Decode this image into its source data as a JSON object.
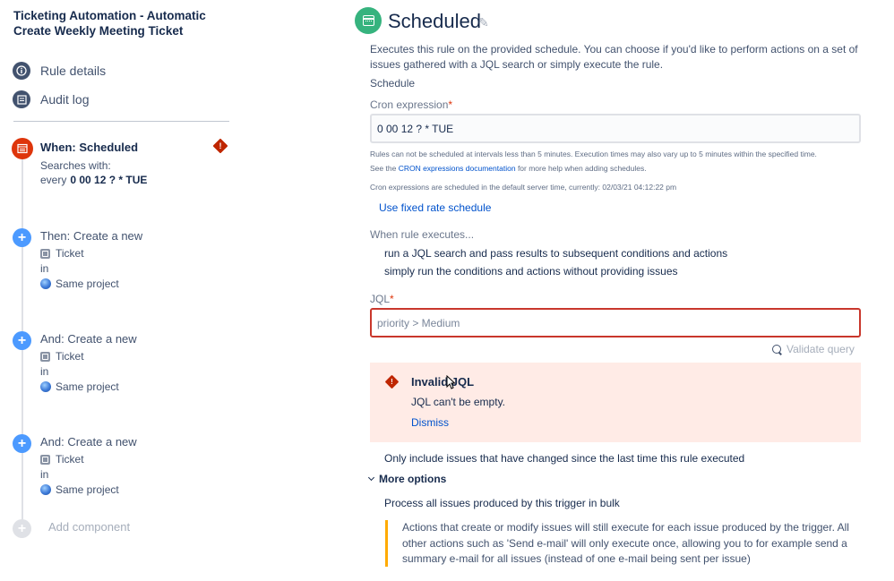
{
  "rule": {
    "title": "Ticketing Automation - Automatic Create Weekly Meeting Ticket"
  },
  "nav": {
    "rule_details": "Rule details",
    "audit_log": "Audit log"
  },
  "components": {
    "trigger": {
      "title": "When: Scheduled",
      "line1": "Searches with:",
      "line2_prefix": "every",
      "line2_value": "0 00 12 ? * TUE"
    },
    "actions": [
      {
        "title": "Then: Create a new",
        "issue_type": "Ticket",
        "in": "in",
        "project": "Same project"
      },
      {
        "title": "And: Create a new",
        "issue_type": "Ticket",
        "in": "in",
        "project": "Same project"
      },
      {
        "title": "And: Create a new",
        "issue_type": "Ticket",
        "in": "in",
        "project": "Same project"
      }
    ],
    "add_component": "Add component"
  },
  "panel": {
    "title": "Scheduled",
    "description": "Executes this rule on the provided schedule. You can choose if you'd like to perform actions on a set of issues gathered with a JQL search or simply execute the rule.",
    "schedule_heading": "Schedule",
    "cron_label": "Cron expression",
    "cron_value": "0 00 12 ? * TUE",
    "help_line1": "Rules can not be scheduled at intervals less than 5 minutes. Execution times may also vary up to 5 minutes within the specified time.",
    "help_line2_prefix": "See the",
    "help_line2_link": "CRON expressions documentation",
    "help_line2_suffix": "for more help when adding schedules.",
    "help_line3": "Cron expressions are scheduled in the default server time, currently: 02/03/21 04:12:22 pm",
    "fixed_rate_link": "Use fixed rate schedule",
    "when_executes_label": "When rule executes...",
    "radio_jql": "run a JQL search and pass results to subsequent conditions and actions",
    "radio_simple": "simply run the conditions and actions without providing issues",
    "jql_label": "JQL",
    "jql_placeholder": "priority > Medium",
    "validate_query": "Validate query",
    "error": {
      "title": "Invalid JQL",
      "message": "JQL can't be empty.",
      "dismiss": "Dismiss"
    },
    "only_changed": "Only include issues that have changed since the last time this rule executed",
    "more_options": "More options",
    "bulk_option": "Process all issues produced by this trigger in bulk",
    "bulk_note": "Actions that create or modify issues will still execute for each issue produced by the trigger. All other actions such as 'Send e-mail' will only execute once, allowing you to for example send a summary e-mail for all issues (instead of one e-mail being sent per issue)"
  },
  "colors": {
    "trigger_red": "#de350b",
    "action_blue": "#4c9aff",
    "scheduled_green": "#36b37e",
    "error_bg": "#ffebe6",
    "link_blue": "#0052cc",
    "note_border": "#ffab00"
  }
}
